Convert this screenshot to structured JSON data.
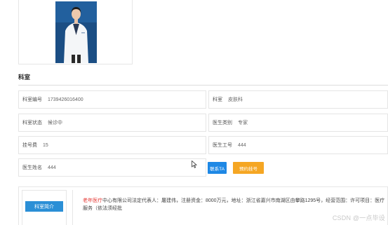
{
  "section": {
    "title": "科室"
  },
  "fields": {
    "dept_code": {
      "label": "科室编号",
      "value": "1739426016400"
    },
    "dept": {
      "label": "科室",
      "value": "皮肤科"
    },
    "dept_status": {
      "label": "科室状态",
      "value": "候诊中"
    },
    "doctor_type": {
      "label": "医生类别",
      "value": "专家"
    },
    "reg_fee": {
      "label": "挂号费",
      "value": "15"
    },
    "doctor_no": {
      "label": "医生工号",
      "value": "444"
    },
    "doctor_name": {
      "label": "医生姓名",
      "value": "444"
    }
  },
  "actions": {
    "contact": "联系TA",
    "book": "预约挂号"
  },
  "intro": {
    "button": "科室简介",
    "brand": "老年医疗",
    "text": "中心有限公司法定代表人：屠建伟，注册资金：8000万元，地址：浙江省嘉兴市南湖区由攀路1295号，经营范围：许可项目：医疗服务（依法须经批"
  },
  "watermark": "CSDN @一点毕设"
}
